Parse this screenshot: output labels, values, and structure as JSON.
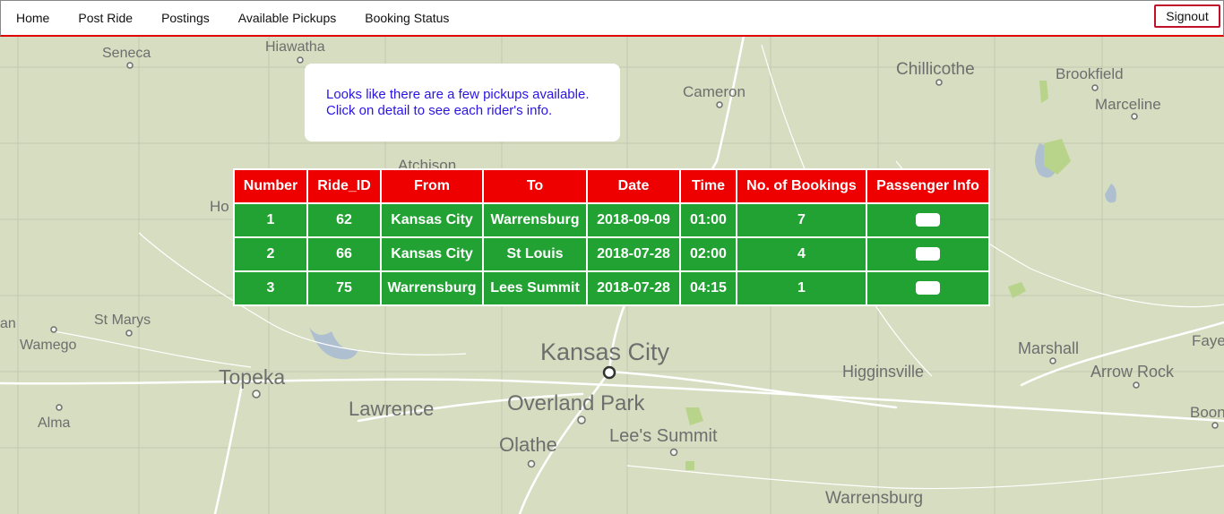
{
  "nav": {
    "items": [
      "Home",
      "Post Ride",
      "Postings",
      "Available Pickups",
      "Booking Status"
    ],
    "signout": "Signout"
  },
  "message": {
    "line1": "Looks like there are a few pickups available.",
    "line2": "Click on detail to see each rider's info."
  },
  "table": {
    "headers": [
      "Number",
      "Ride_ID",
      "From",
      "To",
      "Date",
      "Time",
      "No. of Bookings",
      "Passenger Info"
    ],
    "rows": [
      [
        "1",
        "62",
        "Kansas City",
        "Warrensburg",
        "2018-09-09",
        "01:00",
        "7"
      ],
      [
        "2",
        "66",
        "Kansas City",
        "St Louis",
        "2018-07-28",
        "02:00",
        "4"
      ],
      [
        "3",
        "75",
        "Warrensburg",
        "Lees Summit",
        "2018-07-28",
        "04:15",
        "1"
      ]
    ]
  },
  "map": {
    "labels": [
      "Hiawatha",
      "Seneca",
      "Chillicothe",
      "Brookfield",
      "Marceline",
      "Cameron",
      "Atchison",
      "Ho",
      "St Marys",
      "Wamego",
      "an",
      "Topeka",
      "Lawrence",
      "Kansas City",
      "Overland Park",
      "Olathe",
      "Lee's Summit",
      "Higginsville",
      "Marshall",
      "Arrow Rock",
      "Faye",
      "Boonvil",
      "Alma",
      "Warrensburg"
    ]
  },
  "colors": {
    "header_bg": "#ee0000",
    "row_bg": "#22a233",
    "nav_border": "#e00000",
    "message_text": "#2a14e6"
  }
}
